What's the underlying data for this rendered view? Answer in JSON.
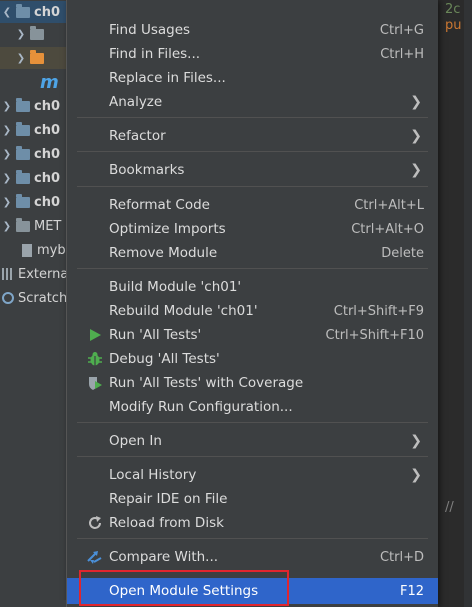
{
  "tree": {
    "rows": [
      {
        "label": "ch0",
        "kind": "module",
        "selected": true
      },
      {
        "label": "",
        "kind": "folder"
      },
      {
        "label": "",
        "kind": "folder-orange"
      },
      {
        "label": "m",
        "kind": "mfile"
      },
      {
        "label": "ch0",
        "kind": "module"
      },
      {
        "label": "ch0",
        "kind": "module"
      },
      {
        "label": "ch0",
        "kind": "module"
      },
      {
        "label": "ch0",
        "kind": "module"
      },
      {
        "label": "ch0",
        "kind": "module"
      },
      {
        "label": "MET",
        "kind": "folder"
      },
      {
        "label": "myb",
        "kind": "file"
      },
      {
        "label": "Externa",
        "kind": "library"
      },
      {
        "label": "Scratch",
        "kind": "scratch"
      }
    ]
  },
  "editor": {
    "code1": "2c",
    "code2": "pu",
    "comment": "//"
  },
  "menu": {
    "find_usages": {
      "label": "Find Usages",
      "shortcut": "Ctrl+G"
    },
    "find_in_files": {
      "label": "Find in Files...",
      "shortcut": "Ctrl+H"
    },
    "replace_in_files": {
      "label": "Replace in Files..."
    },
    "analyze": {
      "label": "Analyze"
    },
    "refactor": {
      "label": "Refactor"
    },
    "bookmarks": {
      "label": "Bookmarks"
    },
    "reformat_code": {
      "label": "Reformat Code",
      "shortcut": "Ctrl+Alt+L"
    },
    "optimize_imports": {
      "label": "Optimize Imports",
      "shortcut": "Ctrl+Alt+O"
    },
    "remove_module": {
      "label": "Remove Module",
      "shortcut": "Delete"
    },
    "build_module": {
      "label": "Build Module 'ch01'"
    },
    "rebuild_module": {
      "label": "Rebuild Module 'ch01'",
      "shortcut": "Ctrl+Shift+F9"
    },
    "run_tests": {
      "label": "Run 'All Tests'",
      "shortcut": "Ctrl+Shift+F10"
    },
    "debug_tests": {
      "label": "Debug 'All Tests'"
    },
    "run_coverage": {
      "label": "Run 'All Tests' with Coverage"
    },
    "modify_run": {
      "label": "Modify Run Configuration..."
    },
    "open_in": {
      "label": "Open In"
    },
    "local_history": {
      "label": "Local History"
    },
    "repair_ide": {
      "label": "Repair IDE on File"
    },
    "reload_disk": {
      "label": "Reload from Disk"
    },
    "compare_with": {
      "label": "Compare With...",
      "shortcut": "Ctrl+D"
    },
    "open_module_settings": {
      "label": "Open Module Settings",
      "shortcut": "F12"
    }
  },
  "colors": {
    "highlight": "#2f65ca",
    "run_green": "#4fae4f",
    "annotation_red": "#e0262e"
  }
}
